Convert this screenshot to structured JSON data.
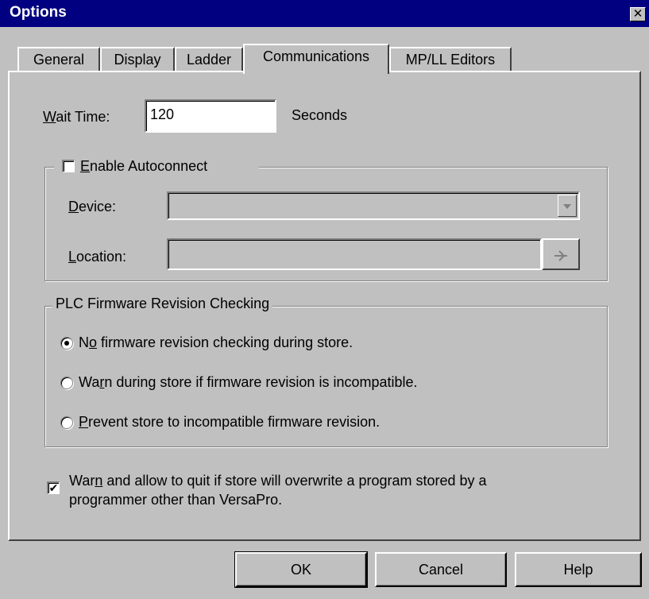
{
  "window": {
    "title": "Options",
    "close_glyph": "✕"
  },
  "tabs": [
    {
      "label": "General",
      "active": false
    },
    {
      "label": "Display",
      "active": false
    },
    {
      "label": "Ladder",
      "active": false
    },
    {
      "label": "Communications",
      "active": true
    },
    {
      "label": "MP/LL Editors",
      "active": false
    }
  ],
  "wait_time": {
    "label_prefix": "",
    "label_mnemonic": "W",
    "label_rest": "ait Time:",
    "value": "120",
    "unit": "Seconds"
  },
  "autoconnect": {
    "mnemonic": "E",
    "label_rest": "nable Autoconnect",
    "checked": false,
    "device": {
      "mnemonic": "D",
      "label_rest": "evice:",
      "value": ""
    },
    "location": {
      "mnemonic": "L",
      "label_rest": "ocation:",
      "value": ""
    }
  },
  "firmware_group": {
    "title": "PLC Firmware Revision Checking",
    "options": [
      {
        "pre": "N",
        "mnemonic": "o",
        "post": " firmware revision checking during store.",
        "selected": true
      },
      {
        "pre": "Wa",
        "mnemonic": "r",
        "post": "n during store if firmware revision is incompatible.",
        "selected": false
      },
      {
        "pre": "",
        "mnemonic": "P",
        "post": "revent store to incompatible firmware revision.",
        "selected": false
      }
    ]
  },
  "warn_option": {
    "pre": "War",
    "mnemonic": "n",
    "post": " and allow to quit if store will overwrite a program stored by a",
    "line2": "programmer other than VersaPro.",
    "checked": true,
    "check_glyph": "✔"
  },
  "buttons": {
    "ok": "OK",
    "cancel": "Cancel",
    "help": "Help"
  },
  "icons": {
    "close": "close-icon",
    "dropdown": "chevron-down-icon",
    "browse": "browse-icon"
  }
}
